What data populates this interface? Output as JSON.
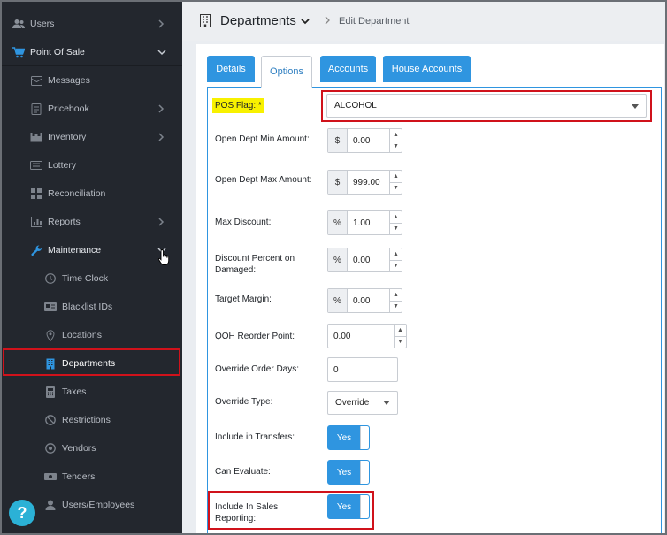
{
  "sidebar": {
    "items": [
      {
        "label": "Users",
        "icon": "users-icon"
      },
      {
        "label": "Point Of Sale",
        "icon": "cart-icon"
      },
      {
        "label": "Messages",
        "icon": "messages-icon"
      },
      {
        "label": "Pricebook",
        "icon": "pricebook-icon"
      },
      {
        "label": "Inventory",
        "icon": "inventory-icon"
      },
      {
        "label": "Lottery",
        "icon": "lottery-icon"
      },
      {
        "label": "Reconciliation",
        "icon": "reconciliation-icon"
      },
      {
        "label": "Reports",
        "icon": "reports-icon"
      },
      {
        "label": "Maintenance",
        "icon": "wrench-icon"
      },
      {
        "label": "Time Clock",
        "icon": "clock-icon"
      },
      {
        "label": "Blacklist IDs",
        "icon": "id-card-icon"
      },
      {
        "label": "Locations",
        "icon": "location-pin-icon"
      },
      {
        "label": "Departments",
        "icon": "building-icon"
      },
      {
        "label": "Taxes",
        "icon": "calculator-icon"
      },
      {
        "label": "Restrictions",
        "icon": "ban-icon"
      },
      {
        "label": "Vendors",
        "icon": "vendor-icon"
      },
      {
        "label": "Tenders",
        "icon": "money-icon"
      },
      {
        "label": "Users/Employees",
        "icon": "user-icon"
      }
    ],
    "help_label": "?"
  },
  "header": {
    "title": "Departments",
    "breadcrumb": "Edit Department"
  },
  "tabs": [
    {
      "label": "Details"
    },
    {
      "label": "Options"
    },
    {
      "label": "Accounts"
    },
    {
      "label": "House Accounts"
    }
  ],
  "form": {
    "pos_flag": {
      "label": "POS Flag: *",
      "value": "ALCOHOL"
    },
    "open_dept_min": {
      "label": "Open Dept Min Amount:",
      "addon": "$",
      "value": "0.00"
    },
    "open_dept_max": {
      "label": "Open Dept Max Amount:",
      "addon": "$",
      "value": "999.00"
    },
    "max_discount": {
      "label": "Max Discount:",
      "addon": "%",
      "value": "1.00"
    },
    "discount_damaged": {
      "label": "Discount Percent on Damaged:",
      "addon": "%",
      "value": "0.00"
    },
    "target_margin": {
      "label": "Target Margin:",
      "addon": "%",
      "value": "0.00"
    },
    "qoh_reorder": {
      "label": "QOH Reorder Point:",
      "value": "0.00"
    },
    "override_days": {
      "label": "Override Order Days:",
      "value": "0"
    },
    "override_type": {
      "label": "Override Type:",
      "value": "Override"
    },
    "include_transfers": {
      "label": "Include in Transfers:",
      "value": "Yes"
    },
    "can_evaluate": {
      "label": "Can Evaluate:",
      "value": "Yes"
    },
    "include_sales": {
      "label": "Include In Sales Reporting:",
      "value": "Yes"
    }
  },
  "colors": {
    "sidebar_bg": "#23272e",
    "accent": "#2f95e0",
    "highlight": "#d0121b",
    "flag_yellow": "#f8f100"
  }
}
